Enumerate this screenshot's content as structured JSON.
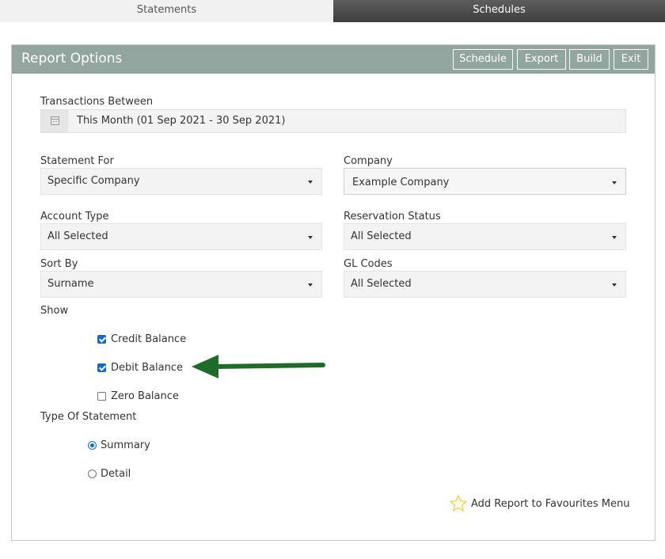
{
  "tabs": [
    {
      "label": "Statements",
      "active": false
    },
    {
      "label": "Schedules",
      "active": true
    }
  ],
  "panel": {
    "title": "Report Options",
    "buttons": {
      "schedule": "Schedule",
      "export": "Export",
      "build": "Build",
      "exit": "Exit"
    }
  },
  "form": {
    "transactions_between": {
      "label": "Transactions Between",
      "value": "This Month (01 Sep 2021 - 30 Sep 2021)",
      "icon": "calendar-icon"
    },
    "statement_for": {
      "label": "Statement For",
      "value": "Specific Company"
    },
    "company": {
      "label": "Company",
      "value": "Example Company"
    },
    "account_type": {
      "label": "Account Type",
      "value": "All Selected"
    },
    "reservation_status": {
      "label": "Reservation Status",
      "value": "All Selected"
    },
    "sort_by": {
      "label": "Sort By",
      "value": "Surname"
    },
    "gl_codes": {
      "label": "GL Codes",
      "value": "All Selected"
    },
    "show": {
      "label": "Show",
      "options": [
        {
          "label": "Credit Balance",
          "checked": true
        },
        {
          "label": "Debit Balance",
          "checked": true
        },
        {
          "label": "Zero Balance",
          "checked": false
        }
      ]
    },
    "type_of_statement": {
      "label": "Type Of Statement",
      "options": [
        {
          "label": "Summary",
          "selected": true
        },
        {
          "label": "Detail",
          "selected": false
        }
      ]
    }
  },
  "favourites": {
    "label": "Add Report to Favourites Menu",
    "icon": "star-icon"
  },
  "annotation": {
    "icon": "green-arrow-icon",
    "color": "#1e6b2a"
  },
  "colors": {
    "header": "#93a59f",
    "active_tab": "#4a4a4a",
    "accent": "#0a6ed1",
    "star": "#f2c94c"
  }
}
